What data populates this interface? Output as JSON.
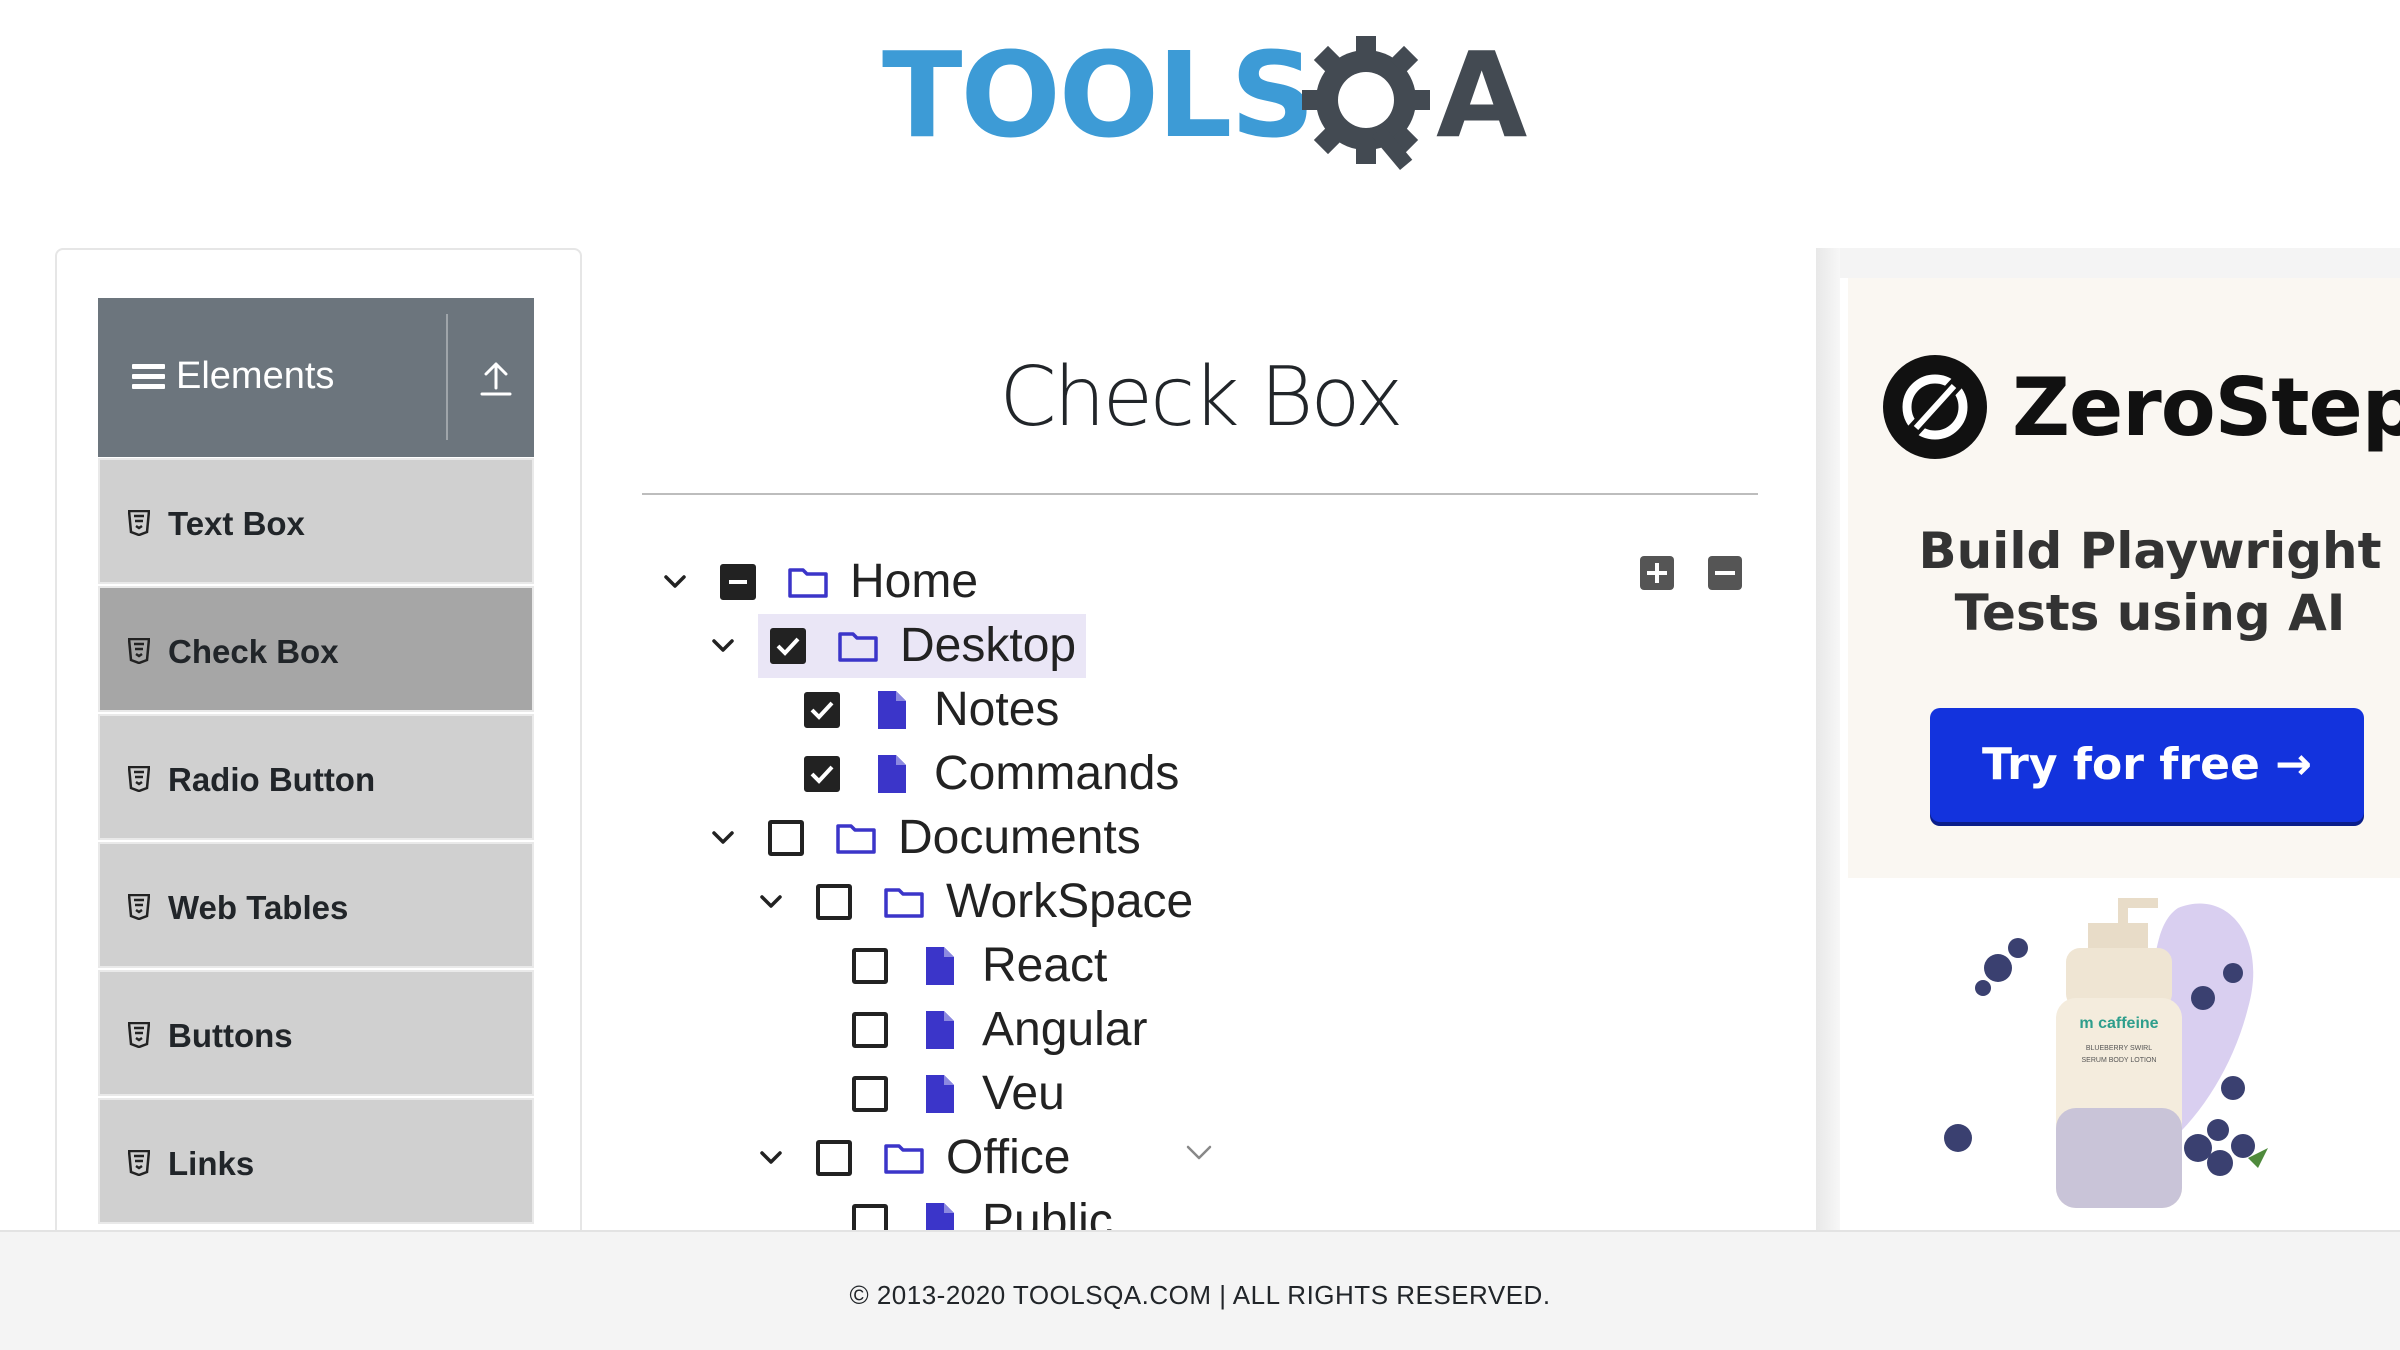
{
  "header": {
    "logo_main": "TOOLS",
    "logo_tail": "A"
  },
  "sidebar": {
    "group_title": "Elements",
    "items": [
      {
        "label": "Text Box",
        "active": false
      },
      {
        "label": "Check Box",
        "active": true
      },
      {
        "label": "Radio Button",
        "active": false
      },
      {
        "label": "Web Tables",
        "active": false
      },
      {
        "label": "Buttons",
        "active": false
      },
      {
        "label": "Links",
        "active": false
      }
    ]
  },
  "main": {
    "title": "Check Box",
    "tree": [
      {
        "label": "Home",
        "type": "folder",
        "expanded": true,
        "state": "partial"
      },
      {
        "label": "Desktop",
        "type": "folder",
        "expanded": true,
        "state": "checked"
      },
      {
        "label": "Notes",
        "type": "file",
        "state": "checked"
      },
      {
        "label": "Commands",
        "type": "file",
        "state": "checked"
      },
      {
        "label": "Documents",
        "type": "folder",
        "expanded": true,
        "state": "unchecked"
      },
      {
        "label": "WorkSpace",
        "type": "folder",
        "expanded": true,
        "state": "unchecked"
      },
      {
        "label": "React",
        "type": "file",
        "state": "unchecked"
      },
      {
        "label": "Angular",
        "type": "file",
        "state": "unchecked"
      },
      {
        "label": "Veu",
        "type": "file",
        "state": "unchecked"
      },
      {
        "label": "Office",
        "type": "folder",
        "expanded": true,
        "state": "unchecked"
      },
      {
        "label": "Public",
        "type": "file",
        "state": "unchecked"
      }
    ]
  },
  "ad": {
    "brand": "ZeroStep",
    "tagline_line1": "Build Playwright",
    "tagline_line2": "Tests using AI",
    "cta": "Try for free →",
    "product_brand": "m caffeine",
    "product_line1": "BLUEBERRY SWIRL",
    "product_line2": "SERUM BODY LOTION"
  },
  "footer": {
    "text": "© 2013-2020 TOOLSQA.COM | ALL RIGHTS RESERVED."
  },
  "colors": {
    "accent_blue": "#3d9bd6",
    "sidebar_header": "#6c757d",
    "menu_item": "#d0d0d0",
    "menu_item_active": "#a6a6a6",
    "tree_icon": "#3b35c9",
    "cta_blue": "#1333dd"
  }
}
